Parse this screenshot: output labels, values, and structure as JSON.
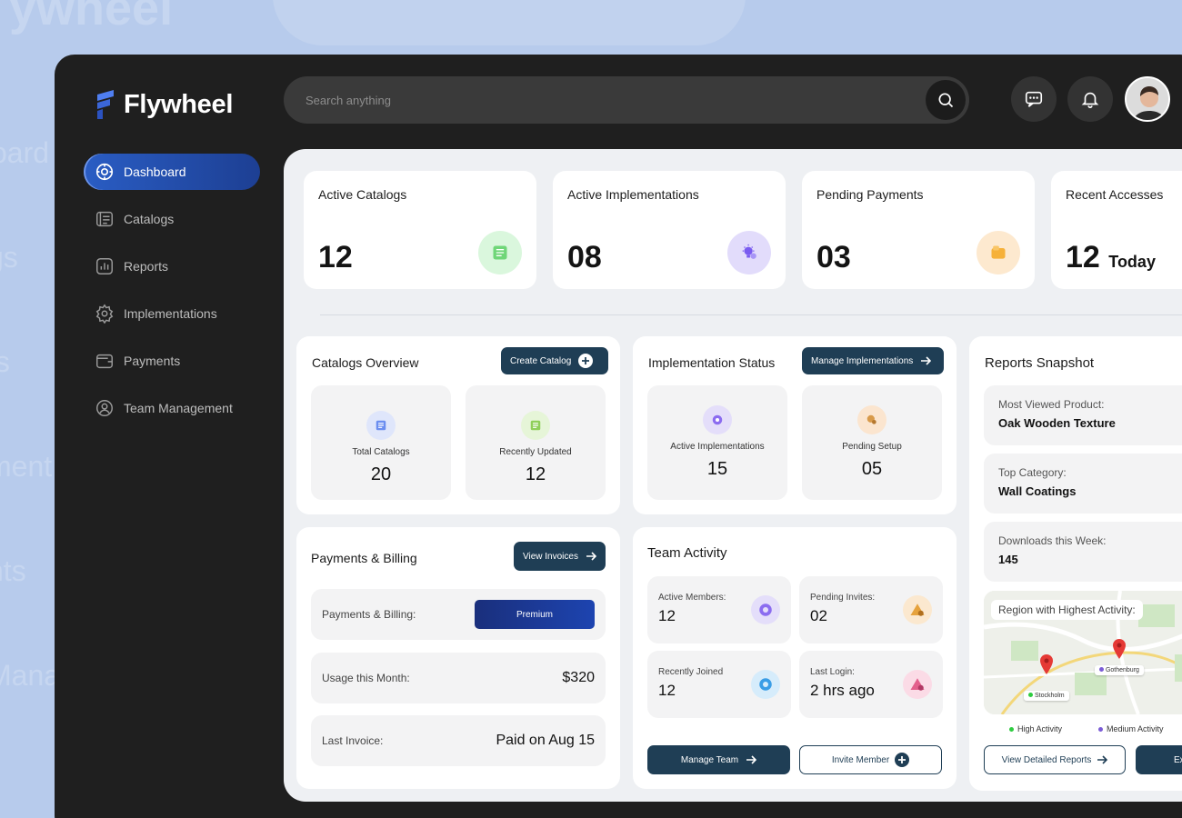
{
  "app": {
    "brand": "Flywheel",
    "colors": {
      "accent": "#2a5dc4",
      "dark_button": "#1f3e55",
      "sidebar_bg": "#1f1f1f",
      "panel_bg": "#eef0f3"
    }
  },
  "sidebar": {
    "items": [
      {
        "label": "Dashboard",
        "icon": "dashboard-icon",
        "active": true
      },
      {
        "label": "Catalogs",
        "icon": "catalog-icon"
      },
      {
        "label": "Reports",
        "icon": "reports-icon"
      },
      {
        "label": "Implementations",
        "icon": "gear-icon"
      },
      {
        "label": "Payments",
        "icon": "wallet-icon"
      },
      {
        "label": "Team Management",
        "icon": "team-icon"
      }
    ]
  },
  "header": {
    "search_placeholder": "Search anything"
  },
  "stats": [
    {
      "label": "Active Catalogs",
      "value": "12",
      "suffix": ""
    },
    {
      "label": "Active Implementations",
      "value": "08",
      "suffix": ""
    },
    {
      "label": "Pending Payments",
      "value": "03",
      "suffix": ""
    },
    {
      "label": "Recent Accesses",
      "value": "12",
      "suffix": "Today"
    }
  ],
  "catalogs_overview": {
    "title": "Catalogs Overview",
    "button": "Create Catalog",
    "tiles": [
      {
        "label": "Total Catalogs",
        "value": "20"
      },
      {
        "label": "Recently Updated",
        "value": "12"
      }
    ]
  },
  "implementation_status": {
    "title": "Implementation Status",
    "button": "Manage Implementations",
    "tiles": [
      {
        "label": "Active Implementations",
        "value": "15"
      },
      {
        "label": "Pending Setup",
        "value": "05"
      }
    ]
  },
  "payments": {
    "title": "Payments & Billing",
    "button": "View Invoices",
    "rows": [
      {
        "label": "Payments & Billing:",
        "value": "Premium"
      },
      {
        "label": "Usage this Month:",
        "value": "$320"
      },
      {
        "label": "Last Invoice:",
        "value": "Paid on Aug 15"
      }
    ]
  },
  "team_activity": {
    "title": "Team Activity",
    "tiles": [
      {
        "label": "Active Members:",
        "value": "12"
      },
      {
        "label": "Pending Invites:",
        "value": "02"
      },
      {
        "label": "Recently Joined",
        "value": "12"
      },
      {
        "label": "Last Login:",
        "value": "2 hrs ago"
      }
    ],
    "manage_button": "Manage Team",
    "invite_button": "Invite Member"
  },
  "reports_snapshot": {
    "title": "Reports Snapshot",
    "items": [
      {
        "label": "Most Viewed Product:",
        "value": "Oak Wooden Texture"
      },
      {
        "label": "Top Category:",
        "value": "Wall Coatings"
      },
      {
        "label": "Downloads this Week:",
        "value": "145"
      }
    ],
    "map_label": "Region with Highest Activity:",
    "map_places": [
      "Gothenburg",
      "Stockholm"
    ],
    "legend": [
      {
        "label": "High Activity",
        "color": "#2ecc40"
      },
      {
        "label": "Medium Activity",
        "color": "#7b5cd6"
      }
    ],
    "detail_button": "View Detailed Reports",
    "export_button": "Ex"
  },
  "background": {
    "ghost_labels": [
      "oard",
      "gs",
      "ts",
      "ment",
      "nts",
      "Mana"
    ],
    "ghost_logo": "ywheel"
  }
}
